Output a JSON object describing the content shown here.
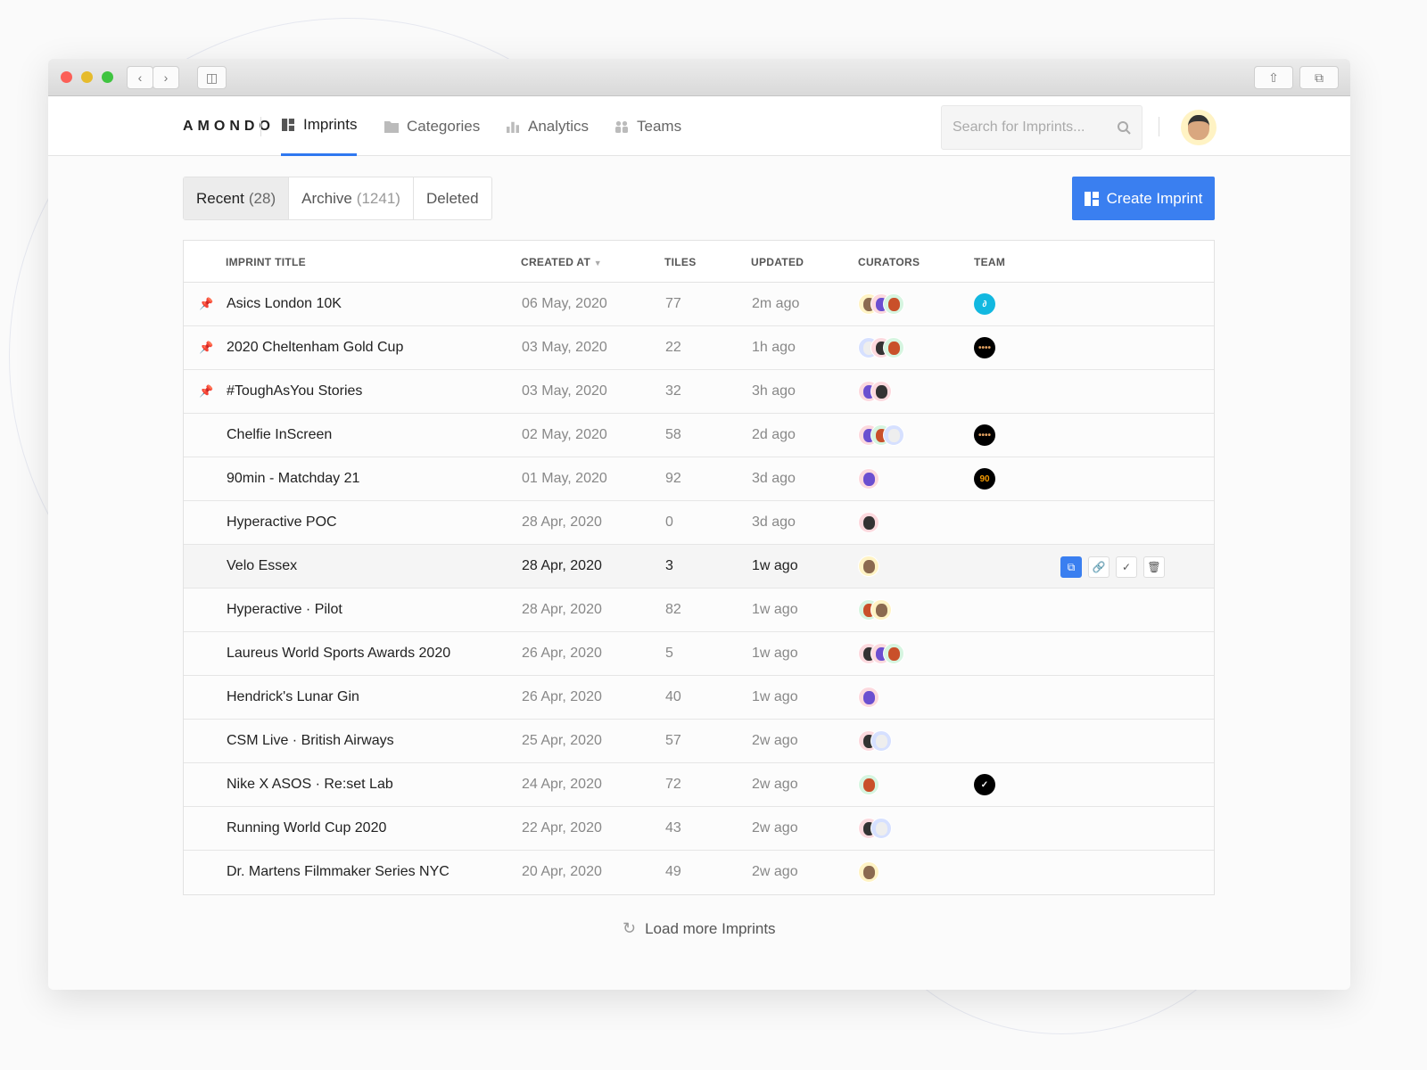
{
  "nav": {
    "logo": "AMONDO",
    "items": [
      {
        "label": "Imprints",
        "active": true
      },
      {
        "label": "Categories"
      },
      {
        "label": "Analytics"
      },
      {
        "label": "Teams"
      }
    ],
    "search_placeholder": "Search for Imprints..."
  },
  "tabs": [
    {
      "label": "Recent",
      "count": "(28)",
      "active": true
    },
    {
      "label": "Archive",
      "count": "(1241)"
    },
    {
      "label": "Deleted",
      "count": ""
    }
  ],
  "create_label": "Create Imprint",
  "columns": {
    "title": "IMPRINT TITLE",
    "created": "CREATED AT",
    "tiles": "TILES",
    "updated": "UPDATED",
    "curators": "CURATORS",
    "team": "TEAM"
  },
  "curator_colors": {
    "memoji": [
      "#fff3c4",
      "#8b6a50"
    ],
    "devil": [
      "#fcd9de",
      "#6b4fd0"
    ],
    "redhead": [
      "#d6f5e0",
      "#c9502a"
    ],
    "skull": [
      "#d6e0ff",
      "#eeeeee"
    ],
    "panda": [
      "#fcd9de",
      "#333333"
    ]
  },
  "team_colors": {
    "asics": [
      "#12b8e0",
      "#ffffff"
    ],
    "dots": [
      "#000000",
      "#e0a060"
    ],
    "90min": [
      "#000000",
      "#f59a00"
    ],
    "nike": [
      "#000000",
      "#ffffff"
    ]
  },
  "rows": [
    {
      "pinned": true,
      "title": "Asics London 10K",
      "created": "06 May, 2020",
      "tiles": "77",
      "updated": "2m ago",
      "curators": [
        "memoji",
        "devil",
        "redhead"
      ],
      "team": "asics"
    },
    {
      "pinned": true,
      "title": "2020 Cheltenham Gold Cup",
      "created": "03 May, 2020",
      "tiles": "22",
      "updated": "1h ago",
      "curators": [
        "skull",
        "panda",
        "redhead"
      ],
      "team": "dots"
    },
    {
      "pinned": true,
      "title": "#ToughAsYou Stories",
      "created": "03 May, 2020",
      "tiles": "32",
      "updated": "3h ago",
      "curators": [
        "devil",
        "panda"
      ],
      "team": null
    },
    {
      "pinned": false,
      "title": "Chelfie InScreen",
      "created": "02 May, 2020",
      "tiles": "58",
      "updated": "2d ago",
      "curators": [
        "devil",
        "redhead",
        "skull"
      ],
      "team": "dots"
    },
    {
      "pinned": false,
      "title": "90min - Matchday 21",
      "created": "01 May, 2020",
      "tiles": "92",
      "updated": "3d ago",
      "curators": [
        "devil"
      ],
      "team": "90min"
    },
    {
      "pinned": false,
      "title": "Hyperactive POC",
      "created": "28 Apr, 2020",
      "tiles": "0",
      "updated": "3d ago",
      "curators": [
        "panda"
      ],
      "team": null
    },
    {
      "pinned": false,
      "title": "Velo Essex",
      "created": "28 Apr, 2020",
      "tiles": "3",
      "updated": "1w ago",
      "curators": [
        "memoji"
      ],
      "team": null,
      "hover": true
    },
    {
      "pinned": false,
      "title": "Hyperactive · Pilot",
      "created": "28 Apr, 2020",
      "tiles": "82",
      "updated": "1w ago",
      "curators": [
        "redhead",
        "memoji"
      ],
      "team": null
    },
    {
      "pinned": false,
      "title": "Laureus World Sports Awards 2020",
      "created": "26 Apr, 2020",
      "tiles": "5",
      "updated": "1w ago",
      "curators": [
        "panda",
        "devil",
        "redhead"
      ],
      "team": null
    },
    {
      "pinned": false,
      "title": "Hendrick's Lunar Gin",
      "created": "26 Apr, 2020",
      "tiles": "40",
      "updated": "1w ago",
      "curators": [
        "devil"
      ],
      "team": null
    },
    {
      "pinned": false,
      "title": "CSM Live · British Airways",
      "created": "25 Apr, 2020",
      "tiles": "57",
      "updated": "2w ago",
      "curators": [
        "panda",
        "skull"
      ],
      "team": null
    },
    {
      "pinned": false,
      "title": "Nike X ASOS · Re:set Lab",
      "created": "24 Apr, 2020",
      "tiles": "72",
      "updated": "2w ago",
      "curators": [
        "redhead"
      ],
      "team": "nike"
    },
    {
      "pinned": false,
      "title": "Running World Cup 2020",
      "created": "22 Apr, 2020",
      "tiles": "43",
      "updated": "2w ago",
      "curators": [
        "panda",
        "skull"
      ],
      "team": null
    },
    {
      "pinned": false,
      "title": "Dr. Martens Filmmaker Series NYC",
      "created": "20 Apr, 2020",
      "tiles": "49",
      "updated": "2w ago",
      "curators": [
        "memoji"
      ],
      "team": null
    }
  ],
  "load_more": "Load more Imprints"
}
